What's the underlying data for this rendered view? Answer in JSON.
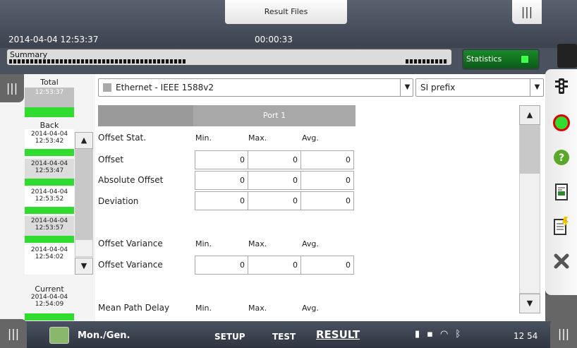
{
  "header": {
    "title": "Result Files",
    "datetime": "2014-04-04 12:53:37",
    "timer": "00:00:33",
    "handle": "|||"
  },
  "summary": {
    "label": "Summary"
  },
  "statistics_button": {
    "label": "Statistics"
  },
  "history": {
    "total_label": "Total",
    "total_time": "12:53:37",
    "back_label": "Back",
    "items": [
      {
        "date": "2014-04-04",
        "time": "12:53:42"
      },
      {
        "date": "2014-04-04",
        "time": "12:53:47"
      },
      {
        "date": "2014-04-04",
        "time": "12:53:52"
      },
      {
        "date": "2014-04-04",
        "time": "12:53:57"
      },
      {
        "date": "2014-04-04",
        "time": "12:54:02"
      }
    ],
    "current_label": "Current",
    "current": {
      "date": "2014-04-04",
      "time": "12:54:09"
    }
  },
  "filters": {
    "interface": "Ethernet - IEEE 1588v2",
    "prefix": "SI prefix"
  },
  "table": {
    "port": "Port 1",
    "sections": [
      {
        "title": "Offset Stat.",
        "cols": [
          "Min.",
          "Max.",
          "Avg."
        ],
        "rows": [
          {
            "label": "Offset",
            "values": [
              "0",
              "0",
              "0"
            ]
          },
          {
            "label": "Absolute Offset",
            "values": [
              "0",
              "0",
              "0"
            ]
          },
          {
            "label": "Deviation",
            "values": [
              "0",
              "0",
              "0"
            ]
          }
        ]
      },
      {
        "title": "Offset Variance",
        "cols": [
          "Min.",
          "Max.",
          "Avg."
        ],
        "rows": [
          {
            "label": "Offset Variance",
            "values": [
              "0",
              "0",
              "0"
            ]
          }
        ]
      },
      {
        "title": "Mean Path Delay",
        "cols": [
          "Min.",
          "Max.",
          "Avg."
        ],
        "rows": []
      }
    ]
  },
  "bottom": {
    "module": "Mon./Gen.",
    "setup": "SETUP",
    "test": "TEST",
    "result": "RESULT",
    "clock": "12 54",
    "handle": "|||"
  },
  "icons": {
    "right_toolbar": [
      "traffic-light-icon",
      "record-icon",
      "help-icon",
      "report-icon",
      "edit-report-icon",
      "tools-icon"
    ],
    "tray": [
      "battery-icon",
      "usb-icon",
      "wifi-icon",
      "bluetooth-icon"
    ]
  },
  "colors": {
    "green": "#2fdc2f",
    "stats_bg": "#0a6a1e",
    "record": "#e00000"
  }
}
